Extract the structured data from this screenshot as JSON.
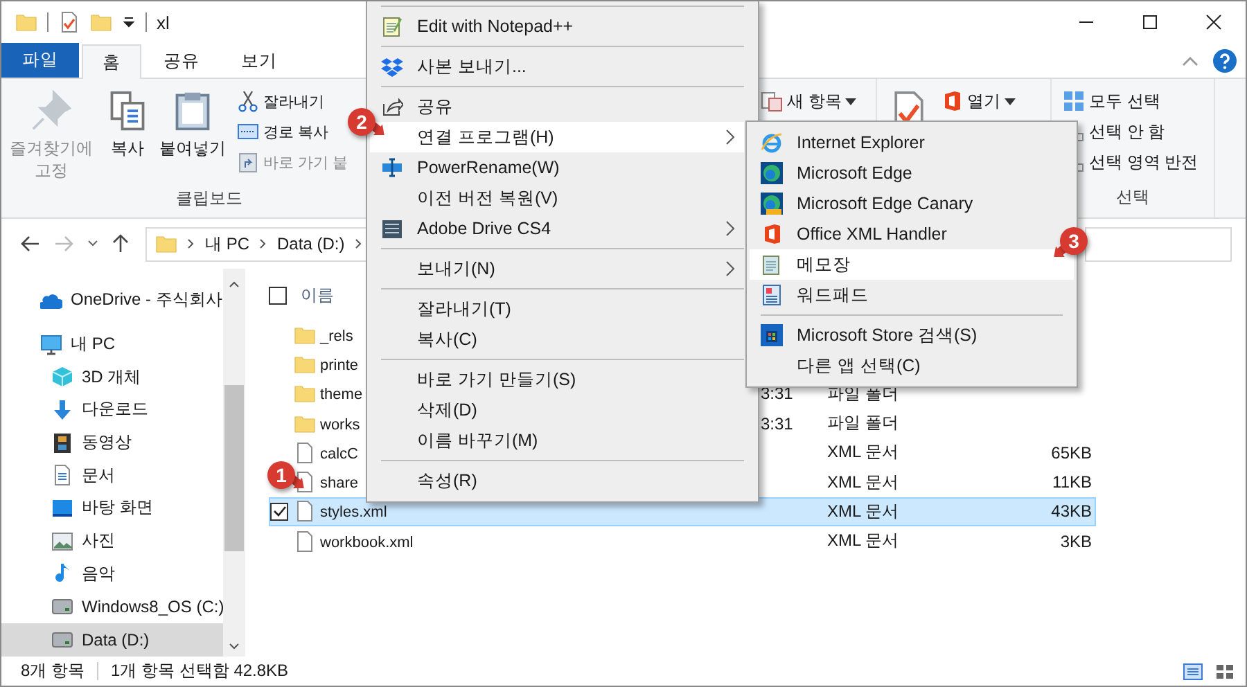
{
  "titlebar": {
    "title": "xl"
  },
  "ribbon_tabs": [
    {
      "label": "파일",
      "kind": "file",
      "selected": false
    },
    {
      "label": "홈",
      "kind": "tab",
      "selected": true
    },
    {
      "label": "공유",
      "kind": "tab",
      "selected": false
    },
    {
      "label": "보기",
      "kind": "tab",
      "selected": false
    }
  ],
  "ribbon": {
    "groups": [
      {
        "label": "클립보드",
        "large": [
          {
            "label": "즐겨찾기에 고정",
            "disabled": true
          },
          {
            "label": "복사",
            "disabled": false
          },
          {
            "label": "붙여넣기",
            "disabled": false
          }
        ],
        "small": [
          {
            "label": "잘라내기",
            "disabled": false,
            "dropdown": false
          },
          {
            "label": "경로 복사",
            "disabled": false,
            "dropdown": false
          },
          {
            "label": "바로 가기 붙",
            "disabled": true,
            "dropdown": false
          }
        ]
      },
      {
        "small": [
          {
            "label": "새 항목",
            "disabled": false,
            "dropdown": true
          }
        ]
      },
      {
        "large": [
          {
            "disabled": false
          }
        ],
        "small": [
          {
            "label": "열기",
            "disabled": false,
            "dropdown": true
          }
        ]
      },
      {
        "label": "선택",
        "small": [
          {
            "label": "모두 선택",
            "disabled": false,
            "dropdown": false
          },
          {
            "label": "선택 안 함",
            "disabled": false,
            "dropdown": false
          },
          {
            "label": "선택 영역 반전",
            "disabled": false,
            "dropdown": false
          }
        ]
      }
    ]
  },
  "address": {
    "crumbs": [
      "내 PC",
      "Data (D:)"
    ]
  },
  "nav": {
    "items": [
      {
        "label": "OneDrive - 주식회사",
        "selected": false
      },
      {
        "label": "내 PC",
        "selected": false,
        "children": [
          {
            "label": "3D 개체",
            "selected": false
          },
          {
            "label": "다운로드",
            "selected": false
          },
          {
            "label": "동영상",
            "selected": false
          },
          {
            "label": "문서",
            "selected": false
          },
          {
            "label": "바탕 화면",
            "selected": false
          },
          {
            "label": "사진",
            "selected": false
          },
          {
            "label": "음악",
            "selected": false
          },
          {
            "label": "Windows8_OS (C:)",
            "selected": false
          },
          {
            "label": "Data (D:)",
            "selected": true
          }
        ]
      }
    ]
  },
  "files": {
    "header": "이름",
    "select_all_checked": false,
    "rows": [
      {
        "name": "_rels",
        "kind": "folder",
        "selected": false
      },
      {
        "name": "printe",
        "kind": "folder",
        "selected": false
      },
      {
        "name": "theme",
        "kind": "folder",
        "date": "3:31",
        "type": "파일 폴더",
        "selected": false
      },
      {
        "name": "works",
        "kind": "folder",
        "date": "3:31",
        "type": "파일 폴더",
        "selected": false
      },
      {
        "name": "calcC",
        "kind": "file",
        "type": "XML 문서",
        "size": "65KB",
        "selected": false
      },
      {
        "name": "share",
        "kind": "file",
        "type": "XML 문서",
        "size": "11KB",
        "selected": false
      },
      {
        "name": "styles.xml",
        "kind": "file",
        "type": "XML 문서",
        "size": "43KB",
        "selected": true
      },
      {
        "name": "workbook.xml",
        "kind": "file",
        "type": "XML 문서",
        "size": "3KB",
        "selected": false
      }
    ]
  },
  "status_bar": {
    "count": "8개 항목",
    "selection": "1개 항목 선택함 42.8KB"
  },
  "context_menu": {
    "items": [
      {
        "kind": "separator"
      },
      {
        "kind": "item",
        "label": "Edit with Notepad++",
        "submenu": false,
        "selected": false
      },
      {
        "kind": "separator"
      },
      {
        "kind": "item",
        "label": "사본 보내기...",
        "submenu": false,
        "selected": false
      },
      {
        "kind": "separator"
      },
      {
        "kind": "item",
        "label": "공유",
        "submenu": false,
        "selected": false
      },
      {
        "kind": "item",
        "label": "연결 프로그램(H)",
        "submenu": true,
        "selected": true
      },
      {
        "kind": "item",
        "label": "PowerRename(W)",
        "submenu": false,
        "selected": false
      },
      {
        "kind": "item",
        "label": "이전 버전 복원(V)",
        "submenu": false,
        "selected": false
      },
      {
        "kind": "item",
        "label": "Adobe Drive CS4",
        "submenu": true,
        "selected": false
      },
      {
        "kind": "separator"
      },
      {
        "kind": "item",
        "label": "보내기(N)",
        "submenu": true,
        "selected": false
      },
      {
        "kind": "separator"
      },
      {
        "kind": "item",
        "label": "잘라내기(T)",
        "submenu": false,
        "selected": false
      },
      {
        "kind": "item",
        "label": "복사(C)",
        "submenu": false,
        "selected": false
      },
      {
        "kind": "separator"
      },
      {
        "kind": "item",
        "label": "바로 가기 만들기(S)",
        "submenu": false,
        "selected": false
      },
      {
        "kind": "item",
        "label": "삭제(D)",
        "submenu": false,
        "selected": false
      },
      {
        "kind": "item",
        "label": "이름 바꾸기(M)",
        "submenu": false,
        "selected": false
      },
      {
        "kind": "separator"
      },
      {
        "kind": "item",
        "label": "속성(R)",
        "submenu": false,
        "selected": false
      }
    ]
  },
  "submenu": {
    "items": [
      {
        "kind": "item",
        "label": "Internet Explorer",
        "selected": false
      },
      {
        "kind": "item",
        "label": "Microsoft Edge",
        "selected": false
      },
      {
        "kind": "item",
        "label": "Microsoft Edge Canary",
        "selected": false
      },
      {
        "kind": "item",
        "label": "Office XML Handler",
        "selected": false
      },
      {
        "kind": "item",
        "label": "메모장",
        "selected": true
      },
      {
        "kind": "item",
        "label": "워드패드",
        "selected": false
      },
      {
        "kind": "separator"
      },
      {
        "kind": "item",
        "label": "Microsoft Store 검색(S)",
        "selected": false
      },
      {
        "kind": "item",
        "label": "다른 앱 선택(C)",
        "selected": false
      }
    ]
  },
  "annotations": [
    {
      "label": "1"
    },
    {
      "label": "2"
    },
    {
      "label": "3"
    }
  ]
}
